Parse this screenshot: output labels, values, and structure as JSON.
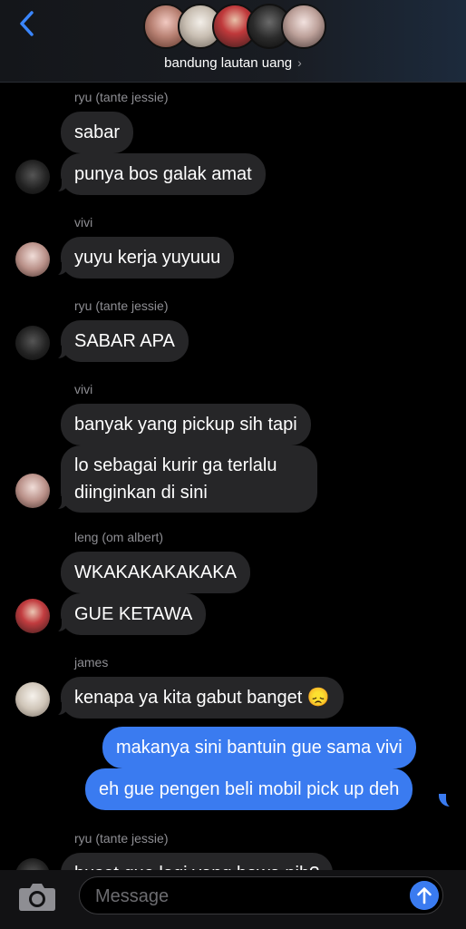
{
  "header": {
    "group_name": "bandung lautan uang",
    "chevron": "›",
    "back_icon": "chevron-left-icon"
  },
  "colors": {
    "incoming_bubble": "#262628",
    "outgoing_bubble": "#3a7bf0",
    "sender_name": "#8e8e93",
    "background": "#000000"
  },
  "messages": {
    "s1": "ryu (tante jessie)",
    "m1": "sabar",
    "m2": "punya bos galak amat",
    "s2": "vivi",
    "m3": "yuyu kerja yuyuuu",
    "s3": "ryu (tante jessie)",
    "m4": "SABAR APA",
    "s4": "vivi",
    "m5": "banyak yang pickup sih tapi",
    "m6": "lo sebagai kurir ga terlalu diinginkan di sini",
    "s5": "leng (om albert)",
    "m7": "WKAKAKAKAKAKA",
    "m8": "GUE KETAWA",
    "s6": "james",
    "m9": "kenapa ya kita gabut banget 😞",
    "o1": "makanya sini bantuin gue sama vivi",
    "o2": "eh gue pengen beli mobil pick up deh",
    "s7": "ryu (tante jessie)",
    "m10": "buset gue lagi yang bawa nih?"
  },
  "composer": {
    "placeholder": "Message",
    "camera_icon": "camera-icon",
    "send_icon": "send-arrow-icon"
  }
}
